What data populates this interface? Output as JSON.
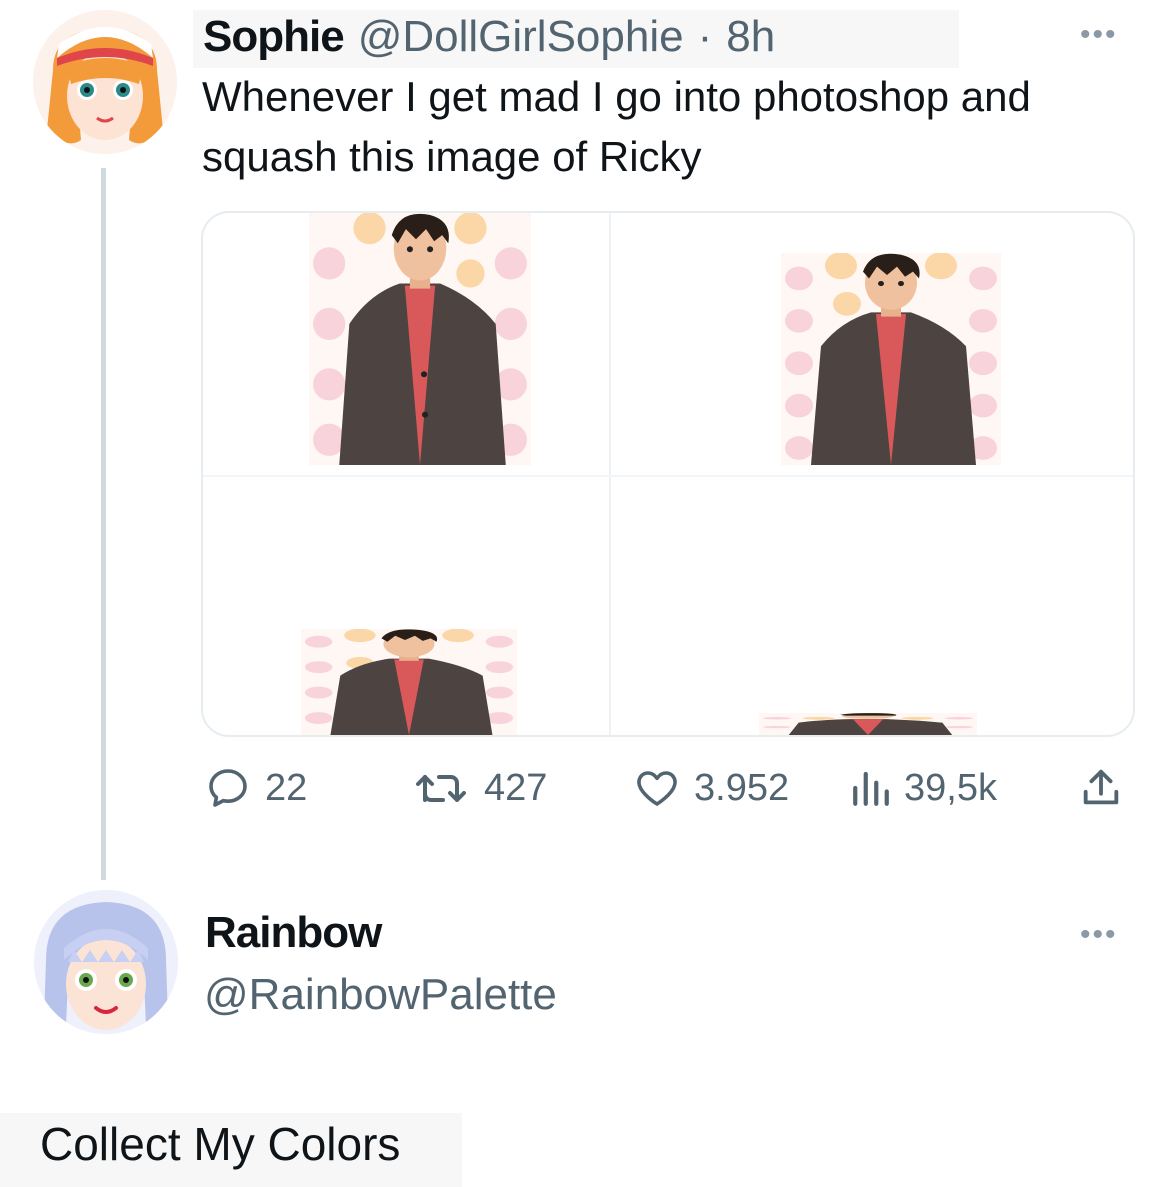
{
  "colors": {
    "text": "#0f1419",
    "secondary": "#536471",
    "thread_line": "#cfd9de",
    "card_border": "#e6ecf0"
  },
  "post": {
    "author_name": "Sophie",
    "author_handle": "@DollGirlSophie",
    "separator": "·",
    "time": "8h",
    "more_icon": "more-dots-icon",
    "text_line1": "Whenever I get mad I go into photoshop and",
    "text_line2": "squash this image of Ricky",
    "media_images": [
      "Ricky",
      "Ricky",
      "Ricky",
      "Ricky"
    ],
    "actions": {
      "replies": "22",
      "reposts": "427",
      "likes": "3.952",
      "views": "39,5k"
    },
    "action_icons": [
      "reply-icon",
      "repost-icon",
      "like-icon",
      "views-icon",
      "share-icon"
    ]
  },
  "reply": {
    "author_name": "Rainbow",
    "author_handle": "@RainbowPalette",
    "more_icon": "more-dots-icon"
  },
  "caption": "Collect My Colors"
}
